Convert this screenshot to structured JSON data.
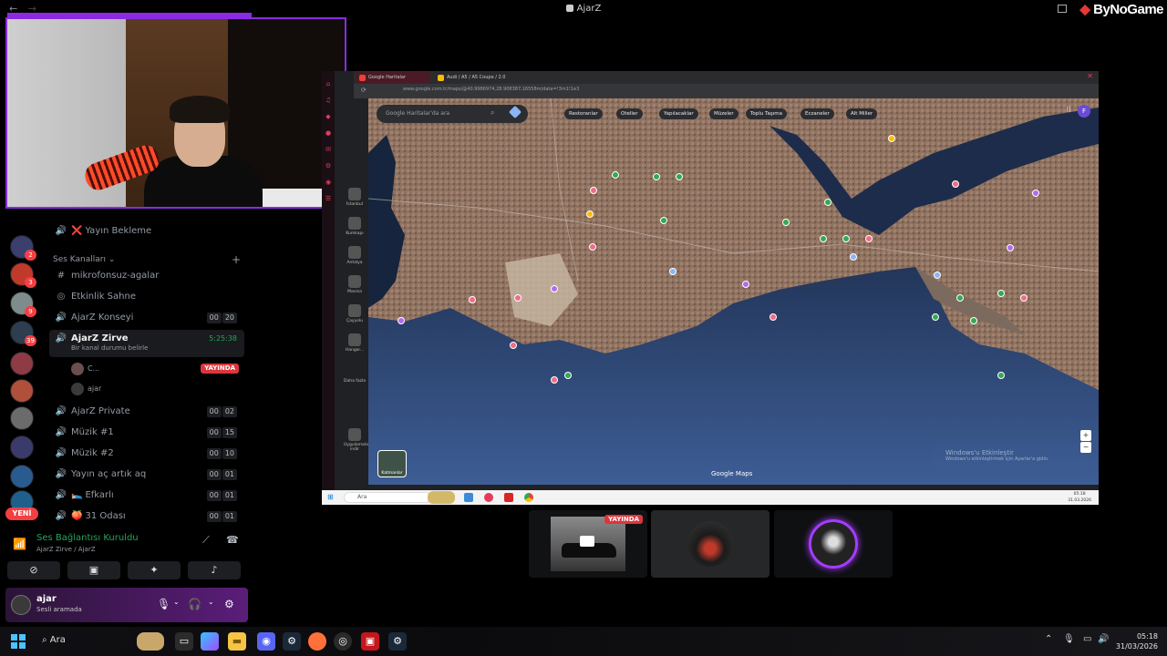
{
  "window": {
    "title": "AjarZ",
    "brand": "ByNoGame",
    "nav_back": "←",
    "nav_forward": "→"
  },
  "sidebar": {
    "servers": [
      {
        "color": "#3a3f6e",
        "badge": "2"
      },
      {
        "color": "#c0392b",
        "badge": "3"
      },
      {
        "color": "#7f8c8d",
        "badge": "9"
      },
      {
        "color": "#2c3e50",
        "badge": "39"
      },
      {
        "color": "#8e3b46",
        "badge": ""
      },
      {
        "color": "#b0503a",
        "badge": ""
      },
      {
        "color": "#6b6b6b",
        "badge": ""
      },
      {
        "color": "#3b3b6b",
        "badge": ""
      },
      {
        "color": "#2a5b8e",
        "badge": ""
      },
      {
        "color": "#1f5f8b",
        "badge": ""
      }
    ],
    "new_badge": "YENİ",
    "channels_top": {
      "label": "Yayın Bekleme",
      "prefix": "❌"
    },
    "section_title": "Ses Kanalları",
    "channels": [
      {
        "name": "mikrofonsuz-agalar",
        "icon": "#",
        "counts": []
      },
      {
        "name": "Etkinlik Sahne",
        "icon": "◎",
        "counts": []
      },
      {
        "name": "AjarZ Konseyi",
        "icon": "🔊",
        "counts": [
          "00",
          "20"
        ]
      },
      {
        "name": "AjarZ Private",
        "icon": "🔊",
        "counts": [
          "00",
          "02"
        ]
      },
      {
        "name": "Müzik #1",
        "icon": "🔊",
        "counts": [
          "00",
          "15"
        ]
      },
      {
        "name": "Müzik #2",
        "icon": "🔊",
        "counts": [
          "00",
          "10"
        ]
      },
      {
        "name": "Yayın aç artık aq",
        "icon": "🔊",
        "counts": [
          "00",
          "01"
        ]
      },
      {
        "name": "Efkarlı",
        "icon": "🔊",
        "prefix": "🛌",
        "counts": [
          "00",
          "01"
        ]
      },
      {
        "name": "31 Odası",
        "icon": "🔊",
        "prefix": "🍑",
        "counts": [
          "00",
          "01"
        ]
      }
    ],
    "active_channel": {
      "name": "AjarZ Zirve",
      "timer": "5:25:38",
      "status": "Bir kanal durumu belirle",
      "members": [
        {
          "name": "C...",
          "live": "YAYINDA"
        },
        {
          "name": "ajar",
          "live": ""
        }
      ]
    },
    "voice": {
      "title": "Ses Bağlantısı Kuruldu",
      "subtitle": "AjarZ Zirve / AjarZ"
    },
    "user": {
      "name": "ajar",
      "status": "Sesli aramada"
    }
  },
  "share": {
    "tabs": [
      {
        "label": "Google Haritalar",
        "color": "#ea4335"
      },
      {
        "label": "Audi / A5 / A5 Coupe / 2.0",
        "color": "#fbbc04"
      }
    ],
    "url": "www.google.com.tr/maps/@40.9986974,28.908387,16558m/data=!3m1!1e3",
    "left_strip": [
      "⌂",
      "♫",
      "◆",
      "●",
      "✉",
      "⚙",
      "◉",
      "☰"
    ],
    "map_sidebar": [
      {
        "label": "İstanbul"
      },
      {
        "label": "Kumkapı"
      },
      {
        "label": "Antalya"
      },
      {
        "label": "Manisa"
      },
      {
        "label": "Çayyolu"
      },
      {
        "label": "Hangar..."
      },
      {
        "label": "Daha fazla"
      },
      {
        "label": "Uygulamaları indir"
      }
    ],
    "search_placeholder": "Google Haritalar'da ara",
    "chips": [
      "Restoranlar",
      "Oteller",
      "Yapılacaklar",
      "Müzeler",
      "Toplu Taşıma",
      "Eczaneler",
      "Alt Miller"
    ],
    "map_logo": "Google Maps",
    "layer_label": "Katmanlar",
    "win_activation_title": "Windows'u Etkinleştir",
    "win_activation_body": "Windows'u etkinleştirmek için Ayarlar'a gidin.",
    "taskbar_search": "Ara",
    "clock_time": "05:18",
    "clock_date": "31.03.2026"
  },
  "thumbs": [
    {
      "live": "YAYINDA"
    },
    {
      "live": ""
    },
    {
      "live": ""
    }
  ],
  "taskbar": {
    "search": "Ara",
    "time": "05:18",
    "date": "31/03/2026"
  }
}
